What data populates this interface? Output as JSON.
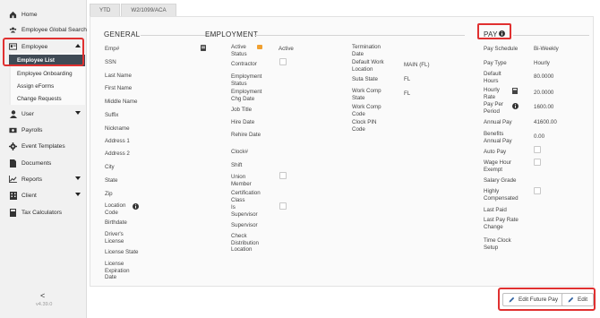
{
  "sidebar": {
    "items": [
      {
        "label": "Home",
        "icon": "home-icon"
      },
      {
        "label": "Employee Global Search",
        "icon": "users-icon"
      },
      {
        "label": "Employee",
        "icon": "id-card-icon"
      },
      {
        "label": "User",
        "icon": "user-icon"
      },
      {
        "label": "Payrolls",
        "icon": "money-icon"
      },
      {
        "label": "Event Templates",
        "icon": "cog-icon"
      },
      {
        "label": "Documents",
        "icon": "document-icon"
      },
      {
        "label": "Reports",
        "icon": "chart-icon"
      },
      {
        "label": "Client",
        "icon": "building-icon"
      },
      {
        "label": "Tax Calculators",
        "icon": "calculator-icon"
      }
    ],
    "employee_sub": [
      "Employee List",
      "Employee Onboarding",
      "Assign eForms",
      "Change Requests"
    ],
    "collapse_glyph": "<",
    "version": "v4.39.0"
  },
  "tabs": [
    "YTD",
    "W2/1099/ACA"
  ],
  "general": {
    "title": "GENERAL",
    "labels": [
      "Emp#",
      "SSN",
      "Last Name",
      "First Name",
      "Middle Name",
      "Suffix",
      "Nickname",
      "Address 1",
      "Address 2",
      "City",
      "State",
      "Zip",
      "Location Code",
      "Birthdate",
      "Driver's License",
      "License State",
      "License Expiration Date"
    ]
  },
  "employment": {
    "title": "EMPLOYMENT",
    "col1": [
      "Active Status",
      "Contractor",
      "Employment Status",
      "Employment Chg Date",
      "Job Title",
      "Hire Date",
      "Rehire Date",
      "Clock#",
      "Shift",
      "Union Member",
      "Certification Class",
      "Is Supervisor",
      "Supervisor",
      "Check Distribution Location"
    ],
    "active_value": "Active",
    "col2": [
      "Termination Date",
      "Default Work Location",
      "Suta State",
      "Work Comp State",
      "Work Comp Code",
      "Clock PIN Code"
    ],
    "col2_values": [
      "",
      "MAIN (FL)",
      "FL",
      "FL",
      "",
      ""
    ]
  },
  "pay": {
    "title": "PAY",
    "labels": [
      "Pay Schedule",
      "Pay Type",
      "Default Hours",
      "Hourly Rate",
      "Pay Per Period",
      "Annual Pay",
      "Benefits Annual Pay",
      "Auto Pay",
      "Wage Hour Exempt",
      "Salary Grade",
      "Highly Compensated",
      "Last Paid",
      "Last Pay Rate Change",
      "Time Clock Setup"
    ],
    "values": [
      "Bi-Weekly",
      "Hourly",
      "80.0000",
      "20.0000",
      "1600.00",
      "41600.00",
      "0.00",
      "",
      "",
      "",
      "",
      "",
      "",
      ""
    ]
  },
  "buttons": {
    "edit_future_pay": "Edit Future Pay",
    "edit": "Edit"
  },
  "colors": {
    "highlight": "#e03030",
    "sidebar_active": "#3f4a55",
    "status_orange": "#f0a030"
  }
}
